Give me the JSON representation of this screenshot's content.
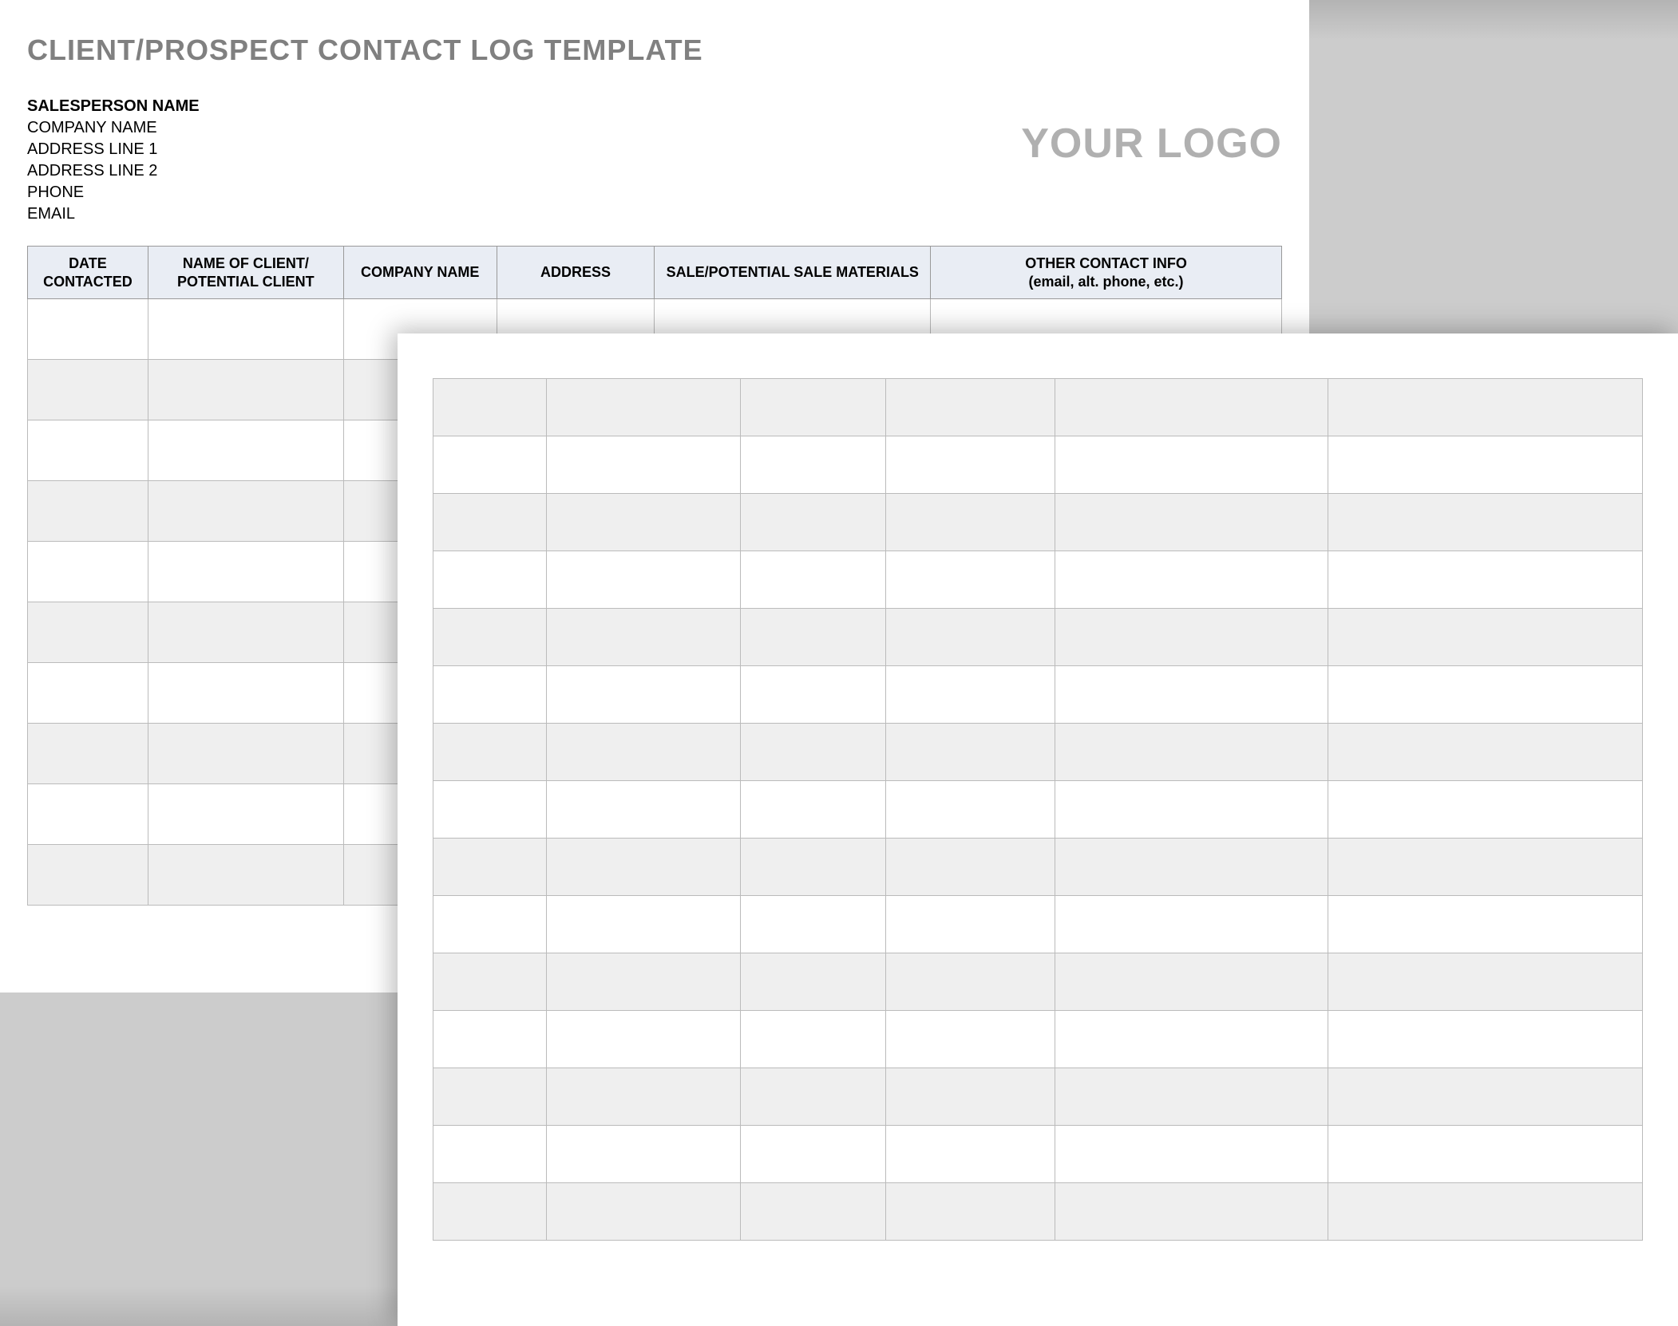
{
  "title": "CLIENT/PROSPECT CONTACT LOG TEMPLATE",
  "salesperson": {
    "name_label": "SALESPERSON NAME",
    "company_label": "COMPANY NAME",
    "address1_label": "ADDRESS LINE 1",
    "address2_label": "ADDRESS LINE 2",
    "phone_label": "PHONE",
    "email_label": "EMAIL"
  },
  "logo_placeholder": "YOUR LOGO",
  "columns": {
    "date": "DATE CONTACTED",
    "client": "NAME OF CLIENT/ POTENTIAL CLIENT",
    "company": "COMPANY NAME",
    "address": "ADDRESS",
    "materials": "SALE/POTENTIAL SALE MATERIALS",
    "other_line1": "OTHER CONTACT INFO",
    "other_line2": "(email, alt. phone, etc.)"
  },
  "page1_rows": 10,
  "page2_rows": 15
}
